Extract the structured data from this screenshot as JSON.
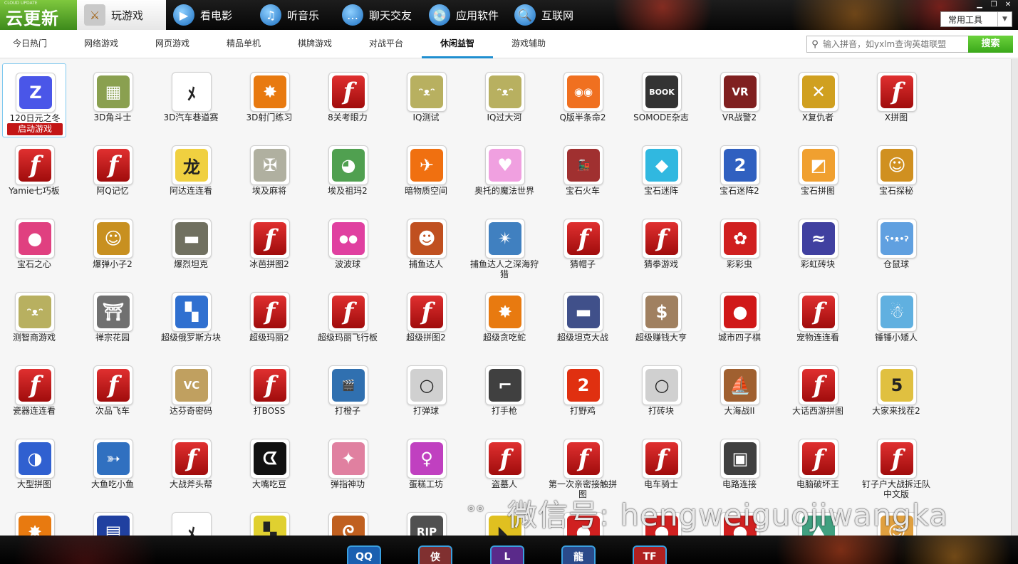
{
  "app": {
    "logo_text": "云更新",
    "logo_sub": "CLOUD UPDATE",
    "tools_label": "常用工具"
  },
  "top_tabs": [
    {
      "label": "玩游戏",
      "icon": "sword-icon"
    },
    {
      "label": "看电影",
      "icon": "media-player-icon"
    },
    {
      "label": "听音乐",
      "icon": "headphones-icon"
    },
    {
      "label": "聊天交友",
      "icon": "chat-bubble-icon"
    },
    {
      "label": "应用软件",
      "icon": "software-box-icon"
    },
    {
      "label": "互联网",
      "icon": "globe-icon"
    }
  ],
  "categories": [
    "今日热门",
    "网络游戏",
    "网页游戏",
    "精品单机",
    "棋牌游戏",
    "对战平台",
    "休闲益智",
    "游戏辅助"
  ],
  "active_category": "休闲益智",
  "search": {
    "placeholder": "输入拼音，如yxlm查询英雄联盟",
    "button": "搜索"
  },
  "launch_label": "启动游戏",
  "games": [
    {
      "name": "120日元之冬",
      "icon": "z-logo-icon",
      "color": "#4a56e8",
      "glyph": "Z",
      "flash": false
    },
    {
      "name": "3D角斗士",
      "icon": "grid-board-icon",
      "color": "#8aa050",
      "glyph": "▦",
      "flash": false
    },
    {
      "name": "3D汽车巷道赛",
      "icon": "runner-icon",
      "color": "#ffffff",
      "glyph": "ﾒ",
      "flash": false
    },
    {
      "name": "3D射门练习",
      "icon": "burst-icon",
      "color": "#e87a10",
      "glyph": "✸",
      "flash": false
    },
    {
      "name": "8关考眼力",
      "icon": "flash-icon",
      "color": "#c81a1a",
      "glyph": "f",
      "flash": true
    },
    {
      "name": "IQ测试",
      "icon": "black-cat-icon",
      "color": "#b8b060",
      "glyph": "ᵔᴥᵔ",
      "flash": false
    },
    {
      "name": "IQ过大河",
      "icon": "black-cat-icon",
      "color": "#b8b060",
      "glyph": "ᵔᴥᵔ",
      "flash": false
    },
    {
      "name": "Q版半条命2",
      "icon": "cartoon-face-icon",
      "color": "#f07020",
      "glyph": "◉◉",
      "flash": false
    },
    {
      "name": "SOMODE杂志",
      "icon": "magazine-icon",
      "color": "#333333",
      "glyph": "BOOK",
      "flash": false
    },
    {
      "name": "VR战警2",
      "icon": "vr-cop-icon",
      "color": "#802020",
      "glyph": "VR",
      "flash": false
    },
    {
      "name": "X复仇者",
      "icon": "x-avenger-icon",
      "color": "#d0a020",
      "glyph": "✕",
      "flash": false
    },
    {
      "name": "X拼图",
      "icon": "flash-icon",
      "color": "#c81a1a",
      "glyph": "f",
      "flash": true
    },
    {
      "name": "Yamie七巧板",
      "icon": "flash-icon",
      "color": "#c81a1a",
      "glyph": "f",
      "flash": true
    },
    {
      "name": "阿Q记忆",
      "icon": "flash-icon",
      "color": "#c81a1a",
      "glyph": "f",
      "flash": true
    },
    {
      "name": "阿达连连看",
      "icon": "dragon-icon",
      "color": "#f0d040",
      "glyph": "龙",
      "flash": false
    },
    {
      "name": "埃及麻将",
      "icon": "scarab-icon",
      "color": "#b0b0a0",
      "glyph": "✠",
      "flash": false
    },
    {
      "name": "埃及祖玛2",
      "icon": "frog-icon",
      "color": "#50a050",
      "glyph": "◕",
      "flash": false
    },
    {
      "name": "暗物质空间",
      "icon": "spaceship-icon",
      "color": "#f07010",
      "glyph": "✈",
      "flash": false
    },
    {
      "name": "奥托的魔法世界",
      "icon": "pink-ghost-icon",
      "color": "#f0a0e0",
      "glyph": "♥",
      "flash": false
    },
    {
      "name": "宝石火车",
      "icon": "train-icon",
      "color": "#a03030",
      "glyph": "🚂",
      "flash": false
    },
    {
      "name": "宝石迷阵",
      "icon": "diamond-icon",
      "color": "#30b8e0",
      "glyph": "◆",
      "flash": false
    },
    {
      "name": "宝石迷阵2",
      "icon": "number-two-icon",
      "color": "#3060c0",
      "glyph": "2",
      "flash": false
    },
    {
      "name": "宝石拼图",
      "icon": "tangram-icon",
      "color": "#f0a030",
      "glyph": "◩",
      "flash": false
    },
    {
      "name": "宝石探秘",
      "icon": "golden-mask-icon",
      "color": "#d09020",
      "glyph": "☺",
      "flash": false
    },
    {
      "name": "宝石之心",
      "icon": "rainbow-orb-icon",
      "color": "#e04080",
      "glyph": "●",
      "flash": false
    },
    {
      "name": "爆弹小子2",
      "icon": "golden-mask-icon",
      "color": "#c89020",
      "glyph": "☺",
      "flash": false
    },
    {
      "name": "爆烈坦克",
      "icon": "tank-icon",
      "color": "#707060",
      "glyph": "▬",
      "flash": false
    },
    {
      "name": "冰芭拼图2",
      "icon": "flash-icon",
      "color": "#c81a1a",
      "glyph": "f",
      "flash": true
    },
    {
      "name": "波波球",
      "icon": "bubbles-icon",
      "color": "#e040a0",
      "glyph": "●●",
      "flash": false
    },
    {
      "name": "捕鱼达人",
      "icon": "cartoon-face-icon",
      "color": "#c05020",
      "glyph": "☻",
      "flash": false
    },
    {
      "name": "捕鱼达人之深海狩猎",
      "icon": "fishing-net-icon",
      "color": "#4080c0",
      "glyph": "✴",
      "flash": false
    },
    {
      "name": "猜帽子",
      "icon": "flash-icon",
      "color": "#c81a1a",
      "glyph": "f",
      "flash": true
    },
    {
      "name": "猜拳游戏",
      "icon": "flash-icon",
      "color": "#c81a1a",
      "glyph": "f",
      "flash": true
    },
    {
      "name": "彩彩虫",
      "icon": "ladybug-icon",
      "color": "#d02020",
      "glyph": "✿",
      "flash": false
    },
    {
      "name": "彩虹砖块",
      "icon": "ribbon-logo-icon",
      "color": "#4040a0",
      "glyph": "≈",
      "flash": false
    },
    {
      "name": "仓鼠球",
      "icon": "hamster-icon",
      "color": "#60a0e0",
      "glyph": "ʕ•ᴥ•ʔ",
      "flash": false
    },
    {
      "name": "测智商游戏",
      "icon": "black-cat-icon",
      "color": "#b8b060",
      "glyph": "ᵔᴥᵔ",
      "flash": false
    },
    {
      "name": "禅宗花园",
      "icon": "stone-lantern-icon",
      "color": "#707070",
      "glyph": "⛩",
      "flash": false
    },
    {
      "name": "超级俄罗斯方块",
      "icon": "tetris-blocks-icon",
      "color": "#3070d0",
      "glyph": "▚",
      "flash": false
    },
    {
      "name": "超级玛丽2",
      "icon": "flash-icon",
      "color": "#c81a1a",
      "glyph": "f",
      "flash": true
    },
    {
      "name": "超级玛丽飞行板",
      "icon": "flash-icon",
      "color": "#c81a1a",
      "glyph": "f",
      "flash": true
    },
    {
      "name": "超级拼图2",
      "icon": "flash-icon",
      "color": "#c81a1a",
      "glyph": "f",
      "flash": true
    },
    {
      "name": "超级贪吃蛇",
      "icon": "burst-icon",
      "color": "#e87a10",
      "glyph": "✸",
      "flash": false
    },
    {
      "name": "超级坦克大战",
      "icon": "tank-icon",
      "color": "#40508a",
      "glyph": "▬",
      "flash": false
    },
    {
      "name": "超级赚钱大亨",
      "icon": "money-bag-icon",
      "color": "#a08060",
      "glyph": "$",
      "flash": false
    },
    {
      "name": "城市四子棋",
      "icon": "red-disc-icon",
      "color": "#d01818",
      "glyph": "●",
      "flash": false
    },
    {
      "name": "宠物连连看",
      "icon": "flash-icon",
      "color": "#c81a1a",
      "glyph": "f",
      "flash": true
    },
    {
      "name": "锤锤小矮人",
      "icon": "gnome-icon",
      "color": "#60b0e0",
      "glyph": "☃",
      "flash": false
    },
    {
      "name": "瓷器连连看",
      "icon": "flash-icon",
      "color": "#c81a1a",
      "glyph": "f",
      "flash": true
    },
    {
      "name": "次品飞车",
      "icon": "flash-icon",
      "color": "#c81a1a",
      "glyph": "f",
      "flash": true
    },
    {
      "name": "达芬奇密码",
      "icon": "monogram-icon",
      "color": "#c0a060",
      "glyph": "VC",
      "flash": false
    },
    {
      "name": "打BOSS",
      "icon": "flash-icon",
      "color": "#c81a1a",
      "glyph": "f",
      "flash": true
    },
    {
      "name": "打橙子",
      "icon": "clapperboard-icon",
      "color": "#3070b0",
      "glyph": "🎬",
      "flash": false
    },
    {
      "name": "打弹球",
      "icon": "white-ball-icon",
      "color": "#d0d0d0",
      "glyph": "○",
      "flash": false
    },
    {
      "name": "打手枪",
      "icon": "pistol-icon",
      "color": "#404040",
      "glyph": "⌐",
      "flash": false
    },
    {
      "name": "打野鸡",
      "icon": "number-two-icon",
      "color": "#e03010",
      "glyph": "2",
      "flash": false
    },
    {
      "name": "打砖块",
      "icon": "white-ball-icon",
      "color": "#d0d0d0",
      "glyph": "○",
      "flash": false
    },
    {
      "name": "大海战II",
      "icon": "sailing-ship-icon",
      "color": "#a06030",
      "glyph": "⛵",
      "flash": false
    },
    {
      "name": "大话西游拼图",
      "icon": "flash-icon",
      "color": "#c81a1a",
      "glyph": "f",
      "flash": true
    },
    {
      "name": "大家来找茬2",
      "icon": "number-five-icon",
      "color": "#e0c040",
      "glyph": "5",
      "flash": false
    },
    {
      "name": "大型拼图",
      "icon": "puzzle-art-icon",
      "color": "#3060d0",
      "glyph": "◑",
      "flash": false
    },
    {
      "name": "大鱼吃小鱼",
      "icon": "fish-icon",
      "color": "#3070c0",
      "glyph": "➳",
      "flash": false
    },
    {
      "name": "大战斧头帮",
      "icon": "flash-icon",
      "color": "#c81a1a",
      "glyph": "f",
      "flash": true
    },
    {
      "name": "大嘴吃豆",
      "icon": "pacman-icon",
      "color": "#111111",
      "glyph": "ᗧ",
      "flash": false
    },
    {
      "name": "弹指神功",
      "icon": "pink-star-icon",
      "color": "#e080a0",
      "glyph": "✦",
      "flash": false
    },
    {
      "name": "蛋糕工坊",
      "icon": "girl-face-icon",
      "color": "#c040c0",
      "glyph": "♀",
      "flash": false
    },
    {
      "name": "盗墓人",
      "icon": "flash-icon",
      "color": "#c81a1a",
      "glyph": "f",
      "flash": true
    },
    {
      "name": "第一次亲密接触拼图",
      "icon": "flash-icon",
      "color": "#c81a1a",
      "glyph": "f",
      "flash": true
    },
    {
      "name": "电车骑士",
      "icon": "flash-icon",
      "color": "#c81a1a",
      "glyph": "f",
      "flash": true
    },
    {
      "name": "电路连接",
      "icon": "chip-icon",
      "color": "#404040",
      "glyph": "▣",
      "flash": false
    },
    {
      "name": "电脑破坏王",
      "icon": "flash-icon",
      "color": "#c81a1a",
      "glyph": "f",
      "flash": true
    },
    {
      "name": "钉子户大战拆迁队中文版",
      "icon": "flash-icon",
      "color": "#c81a1a",
      "glyph": "f",
      "flash": true
    },
    {
      "name": "",
      "icon": "burst-icon",
      "color": "#e87a10",
      "glyph": "✸",
      "flash": false
    },
    {
      "name": "",
      "icon": "game-box-icon",
      "color": "#2040a0",
      "glyph": "▤",
      "flash": false
    },
    {
      "name": "",
      "icon": "runner-icon",
      "color": "#ffffff",
      "glyph": "ﾒ",
      "flash": false
    },
    {
      "name": "",
      "icon": "tetris-blocks-icon",
      "color": "#e0d030",
      "glyph": "▚",
      "flash": false
    },
    {
      "name": "",
      "icon": "dragon-icon",
      "color": "#c06020",
      "glyph": "ᘓ",
      "flash": false
    },
    {
      "name": "",
      "icon": "tombstone-icon",
      "color": "#505050",
      "glyph": "RIP",
      "flash": false
    },
    {
      "name": "",
      "icon": "yellow-shape-icon",
      "color": "#e0c020",
      "glyph": "◣",
      "flash": false
    },
    {
      "name": "",
      "icon": "angry-bird-icon",
      "color": "#d02020",
      "glyph": "●",
      "flash": false
    },
    {
      "name": "",
      "icon": "angry-bird-icon",
      "color": "#d02020",
      "glyph": "●",
      "flash": false
    },
    {
      "name": "",
      "icon": "angry-bird-icon",
      "color": "#d02020",
      "glyph": "●",
      "flash": false
    },
    {
      "name": "",
      "icon": "landscape-icon",
      "color": "#40a080",
      "glyph": "⛰",
      "flash": false
    },
    {
      "name": "",
      "icon": "cartoon-face-icon",
      "color": "#e0a040",
      "glyph": "☺",
      "flash": false
    }
  ],
  "bottom_apps": [
    {
      "icon": "qq-penguin-icon",
      "glyph": "QQ",
      "color": "#1a5fb0"
    },
    {
      "icon": "game-character-icon",
      "glyph": "侠",
      "color": "#803030"
    },
    {
      "icon": "lol-logo-icon",
      "glyph": "L",
      "color": "#5a2a8a"
    },
    {
      "icon": "dragon-nest-icon",
      "glyph": "龍",
      "color": "#2a4a8a"
    },
    {
      "icon": "tf-logo-icon",
      "glyph": "TF",
      "color": "#b02020"
    }
  ],
  "watermark": "微信号: hengweiguojiwangka"
}
